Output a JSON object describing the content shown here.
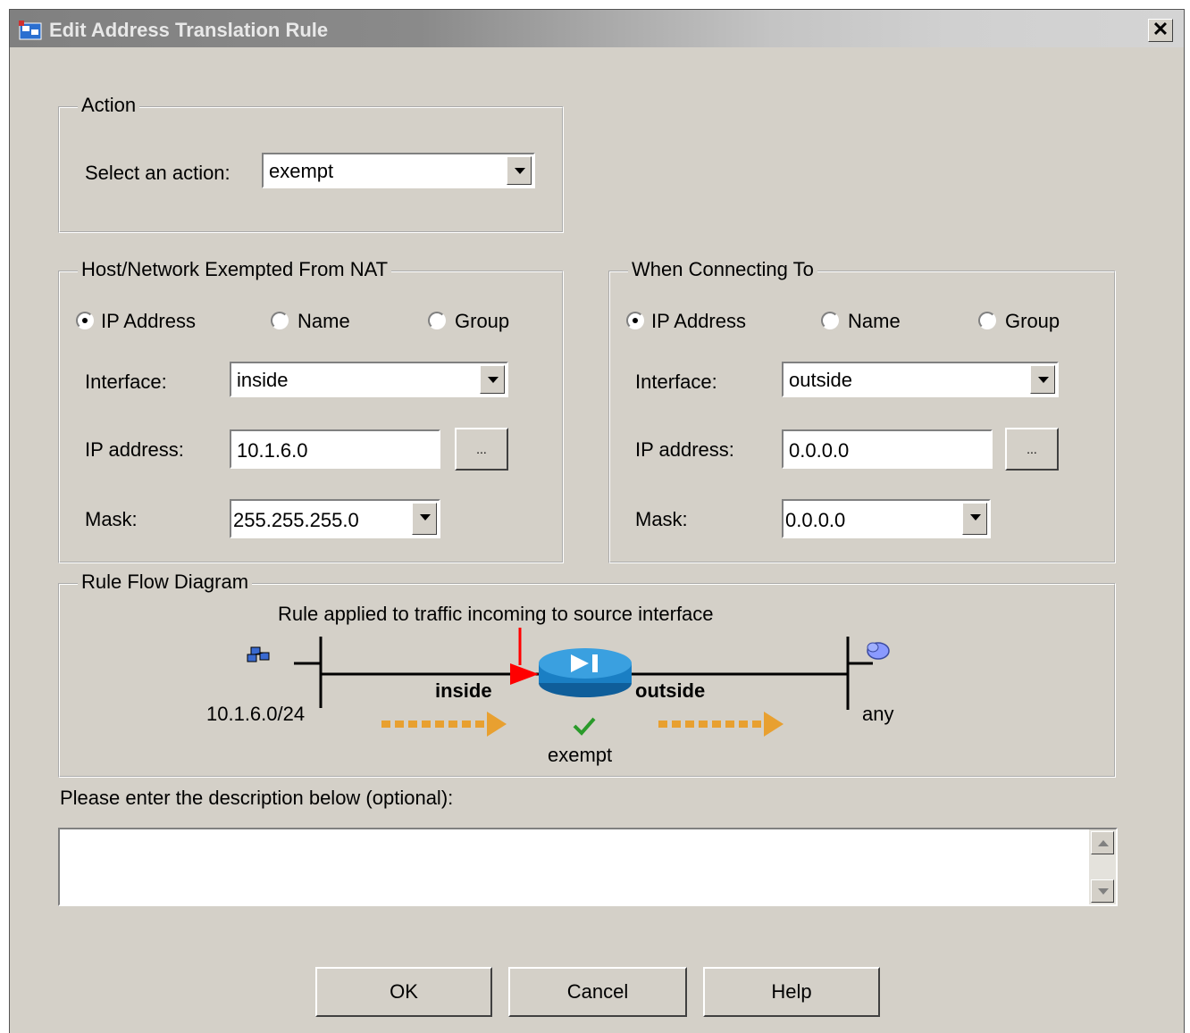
{
  "window": {
    "title": "Edit Address Translation Rule",
    "close_label": "✕"
  },
  "action": {
    "legend": "Action",
    "select_label": "Select an action:",
    "selected": "exempt"
  },
  "source": {
    "legend": "Host/Network Exempted From NAT",
    "radio_ip": "IP Address",
    "radio_name": "Name",
    "radio_group": "Group",
    "selected_radio": "IP Address",
    "interface_label": "Interface:",
    "interface_value": "inside",
    "ip_label": "IP address:",
    "ip_value": "10.1.6.0",
    "browse_label": "...",
    "mask_label": "Mask:",
    "mask_value": "255.255.255.0"
  },
  "destination": {
    "legend": "When Connecting To",
    "radio_ip": "IP Address",
    "radio_name": "Name",
    "radio_group": "Group",
    "selected_radio": "IP Address",
    "interface_label": "Interface:",
    "interface_value": "outside",
    "ip_label": "IP address:",
    "ip_value": "0.0.0.0",
    "browse_label": "...",
    "mask_label": "Mask:",
    "mask_value": "0.0.0.0"
  },
  "diagram": {
    "legend": "Rule Flow Diagram",
    "caption": "Rule applied to traffic incoming to source interface",
    "inside_label": "inside",
    "outside_label": "outside",
    "source_net": "10.1.6.0/24",
    "dest_net": "any",
    "action_label": "exempt",
    "colors": {
      "arrow": "#e8a030",
      "router": "#1a7fc4",
      "pointer": "#ff0000",
      "check": "#2a9a2a"
    }
  },
  "description": {
    "label": "Please enter the description below (optional):",
    "value": ""
  },
  "buttons": {
    "ok": "OK",
    "cancel": "Cancel",
    "help": "Help"
  }
}
